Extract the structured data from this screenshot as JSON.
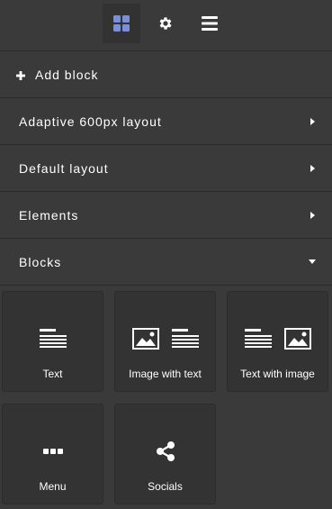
{
  "toolbar": {
    "buttons": [
      {
        "icon": "grid-icon",
        "active": true
      },
      {
        "icon": "gear-icon",
        "active": false
      },
      {
        "icon": "menu-lines-icon",
        "active": false
      }
    ]
  },
  "add_block": {
    "icon": "plus-icon",
    "label": "Add block"
  },
  "sections": [
    {
      "label": "Adaptive 600px layout",
      "state": "collapsed"
    },
    {
      "label": "Default layout",
      "state": "collapsed"
    },
    {
      "label": "Elements",
      "state": "collapsed"
    },
    {
      "label": "Blocks",
      "state": "expanded"
    }
  ],
  "blocks": [
    {
      "label": "Text",
      "icons": [
        "text-lines-icon"
      ]
    },
    {
      "label": "Image with text",
      "icons": [
        "image-icon",
        "text-lines-icon"
      ]
    },
    {
      "label": "Text with image",
      "icons": [
        "text-lines-icon",
        "image-icon"
      ]
    },
    {
      "label": "Menu",
      "icons": [
        "dots-icon"
      ]
    },
    {
      "label": "Socials",
      "icons": [
        "share-icon"
      ]
    }
  ],
  "colors": {
    "background": "#3a3a3a",
    "tile": "#333333",
    "active_tool_icon": "#7b8fd9",
    "text": "#ffffff"
  }
}
